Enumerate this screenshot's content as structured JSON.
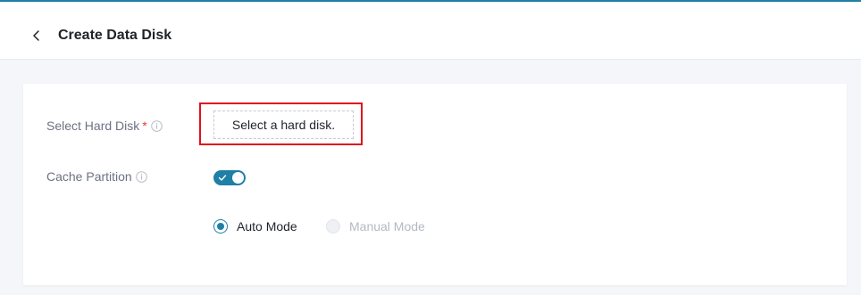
{
  "header": {
    "title": "Create Data Disk",
    "back_icon": "chevron-left-icon"
  },
  "form": {
    "hard_disk": {
      "label": "Select Hard Disk",
      "required_mark": "*",
      "info_icon": "info-icon",
      "button_label": "Select a hard disk."
    },
    "cache_partition": {
      "label": "Cache Partition",
      "info_icon": "info-icon",
      "enabled": true
    },
    "mode": {
      "options": [
        {
          "label": "Auto Mode",
          "selected": true,
          "disabled": false
        },
        {
          "label": "Manual Mode",
          "selected": false,
          "disabled": true
        }
      ]
    }
  },
  "colors": {
    "accent": "#1f7fa6",
    "required": "#e53935",
    "highlight": "#e0121d",
    "background": "#f4f6f9"
  }
}
